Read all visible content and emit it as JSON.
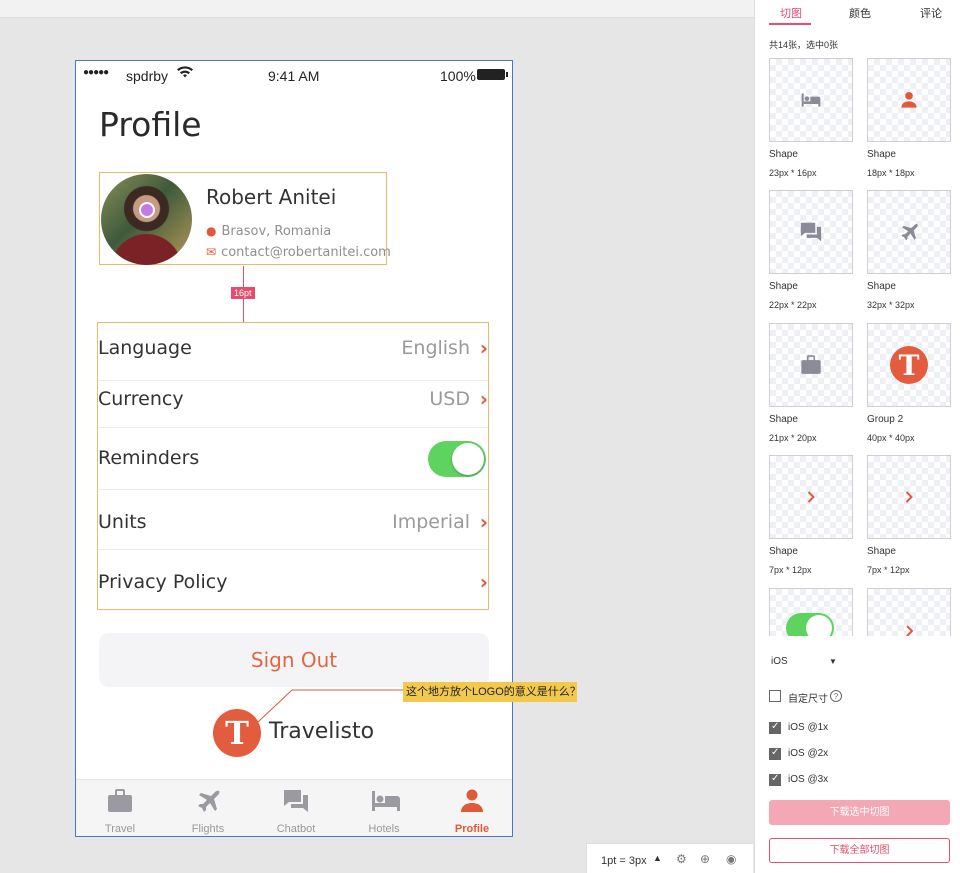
{
  "status": {
    "carrier": "spdrby",
    "time": "9:41 AM",
    "battery": "100%"
  },
  "page": {
    "title": "Profile"
  },
  "profile": {
    "name": "Robert Anitei",
    "location": "Brasov, Romania",
    "email": "contact@robertanitei.com"
  },
  "spacing_tag": "16pt",
  "settings": [
    {
      "label": "Language",
      "value": "English"
    },
    {
      "label": "Currency",
      "value": "USD"
    },
    {
      "label": "Reminders",
      "toggle": true
    },
    {
      "label": "Units",
      "value": "Imperial"
    },
    {
      "label": "Privacy Policy",
      "value": ""
    }
  ],
  "signout": "Sign Out",
  "brand": {
    "logo_letter": "T",
    "name": "Travelisto"
  },
  "tabs": [
    {
      "label": "Travel",
      "icon": "briefcase-icon"
    },
    {
      "label": "Flights",
      "icon": "airplane-icon"
    },
    {
      "label": "Chatbot",
      "icon": "chat-icon"
    },
    {
      "label": "Hotels",
      "icon": "bed-icon"
    },
    {
      "label": "Profile",
      "icon": "person-icon",
      "active": true
    }
  ],
  "annotation": "这个地方放个LOGO的意义是什么？",
  "zoom": "1pt = 3px",
  "panel": {
    "tabs": [
      "切图",
      "颜色",
      "评论"
    ],
    "count": "共14张，选中0张",
    "assets": [
      {
        "name": "Shape",
        "size": "23px * 16px",
        "icon": "bed-icon"
      },
      {
        "name": "Shape",
        "size": "18px * 18px",
        "icon": "person-icon"
      },
      {
        "name": "Shape",
        "size": "22px * 22px",
        "icon": "chat-icon"
      },
      {
        "name": "Shape",
        "size": "32px * 32px",
        "icon": "airplane-icon"
      },
      {
        "name": "Shape",
        "size": "21px * 20px",
        "icon": "briefcase-icon"
      },
      {
        "name": "Group 2",
        "size": "40px * 40px",
        "icon": "logo-icon"
      },
      {
        "name": "Shape",
        "size": "7px * 12px",
        "icon": "chevron-right-icon"
      },
      {
        "name": "Shape",
        "size": "7px * 12px",
        "icon": "chevron-right-icon"
      },
      {
        "name": "",
        "size": "",
        "icon": "toggle-icon"
      },
      {
        "name": "",
        "size": "",
        "icon": "chevron-right-icon"
      }
    ],
    "platform": "iOS",
    "custom_size": "自定尺寸",
    "scales": [
      "iOS @1x",
      "iOS @2x",
      "iOS @3x"
    ],
    "download_selected": "下载选中切图",
    "download_all": "下载全部切图"
  },
  "colors": {
    "accent": "#e05a3a",
    "pink": "#e74c6b",
    "toggle": "#5fd35f",
    "selection": "#4a73d6",
    "guide": "#f0b765"
  }
}
